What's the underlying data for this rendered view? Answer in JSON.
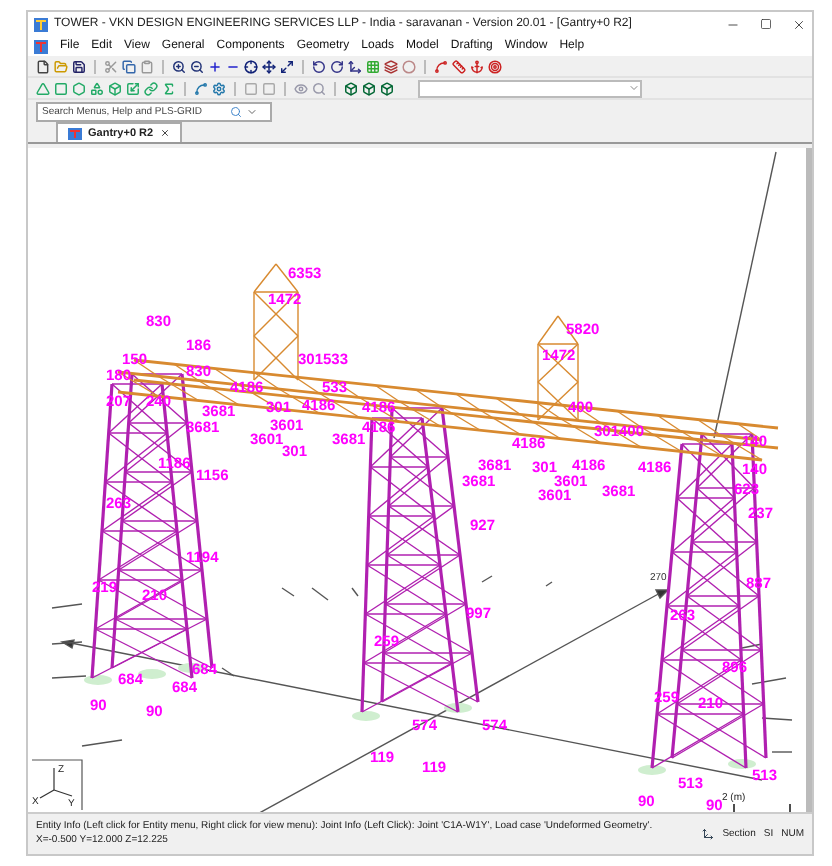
{
  "window": {
    "title": "TOWER - VKN DESIGN ENGINEERING SERVICES LLP - India - saravanan - Version 20.01 - [Gantry+0 R2]"
  },
  "menu": [
    "File",
    "Edit",
    "View",
    "General",
    "Components",
    "Geometry",
    "Loads",
    "Model",
    "Drafting",
    "Window",
    "Help"
  ],
  "search": {
    "placeholder": "Search Menus, Help and PLS-GRID"
  },
  "tabs": [
    {
      "label": "Gantry+0 R2",
      "selected": true
    }
  ],
  "model_view": {
    "labels": [
      {
        "text": "6353",
        "kind": "joint"
      },
      {
        "text": "1472",
        "kind": "joint"
      },
      {
        "text": "830",
        "kind": "joint"
      },
      {
        "text": "186",
        "kind": "joint"
      },
      {
        "text": "150",
        "kind": "joint"
      },
      {
        "text": "180",
        "kind": "joint"
      },
      {
        "text": "830",
        "kind": "joint"
      },
      {
        "text": "301533",
        "kind": "joint"
      },
      {
        "text": "4186",
        "kind": "joint"
      },
      {
        "text": "533",
        "kind": "joint"
      },
      {
        "text": "3681",
        "kind": "joint"
      },
      {
        "text": "301",
        "kind": "joint"
      },
      {
        "text": "4186",
        "kind": "joint"
      },
      {
        "text": "4186",
        "kind": "joint"
      },
      {
        "text": "3681",
        "kind": "joint"
      },
      {
        "text": "3601",
        "kind": "joint"
      },
      {
        "text": "3601",
        "kind": "joint"
      },
      {
        "text": "301",
        "kind": "joint"
      },
      {
        "text": "3681",
        "kind": "joint"
      },
      {
        "text": "4186",
        "kind": "joint"
      },
      {
        "text": "207",
        "kind": "joint"
      },
      {
        "text": "240",
        "kind": "joint"
      },
      {
        "text": "1156",
        "kind": "joint"
      },
      {
        "text": "1186",
        "kind": "joint"
      },
      {
        "text": "263",
        "kind": "joint"
      },
      {
        "text": "5820",
        "kind": "joint"
      },
      {
        "text": "1472",
        "kind": "joint"
      },
      {
        "text": "400",
        "kind": "joint"
      },
      {
        "text": "301400",
        "kind": "joint"
      },
      {
        "text": "4186",
        "kind": "joint"
      },
      {
        "text": "3681",
        "kind": "joint"
      },
      {
        "text": "301",
        "kind": "joint"
      },
      {
        "text": "4186",
        "kind": "joint"
      },
      {
        "text": "3681",
        "kind": "joint"
      },
      {
        "text": "3601",
        "kind": "joint"
      },
      {
        "text": "3601",
        "kind": "joint"
      },
      {
        "text": "3681",
        "kind": "joint"
      },
      {
        "text": "4186",
        "kind": "joint"
      },
      {
        "text": "140",
        "kind": "joint"
      },
      {
        "text": "140",
        "kind": "joint"
      },
      {
        "text": "623",
        "kind": "joint"
      },
      {
        "text": "237",
        "kind": "joint"
      },
      {
        "text": "1194",
        "kind": "joint"
      },
      {
        "text": "219",
        "kind": "joint"
      },
      {
        "text": "210",
        "kind": "joint"
      },
      {
        "text": "684",
        "kind": "joint"
      },
      {
        "text": "684",
        "kind": "joint"
      },
      {
        "text": "684",
        "kind": "joint"
      },
      {
        "text": "90",
        "kind": "joint"
      },
      {
        "text": "90",
        "kind": "joint"
      },
      {
        "text": "259",
        "kind": "joint"
      },
      {
        "text": "927",
        "kind": "joint"
      },
      {
        "text": "997",
        "kind": "joint"
      },
      {
        "text": "574",
        "kind": "joint"
      },
      {
        "text": "574",
        "kind": "joint"
      },
      {
        "text": "119",
        "kind": "joint"
      },
      {
        "text": "119",
        "kind": "joint"
      },
      {
        "text": "887",
        "kind": "joint"
      },
      {
        "text": "263",
        "kind": "joint"
      },
      {
        "text": "896",
        "kind": "joint"
      },
      {
        "text": "259",
        "kind": "joint"
      },
      {
        "text": "210",
        "kind": "joint"
      },
      {
        "text": "513",
        "kind": "joint"
      },
      {
        "text": "513",
        "kind": "joint"
      },
      {
        "text": "90",
        "kind": "joint"
      },
      {
        "text": "90",
        "kind": "joint"
      },
      {
        "text": "270",
        "kind": "dimension"
      }
    ],
    "axes": [
      "Z",
      "X",
      "Y"
    ],
    "scale": "2 (m)"
  },
  "status_bar": {
    "message": "Entity Info (Left click for Entity menu, Right click for view menu): Joint Info (Left Click): Joint 'C1A-W1Y', Load case 'Undeformed Geometry'.",
    "coordinates": "X=-0.500 Y=12.000 Z=12.225",
    "section": "Section",
    "units": "SI",
    "num": "NUM"
  }
}
